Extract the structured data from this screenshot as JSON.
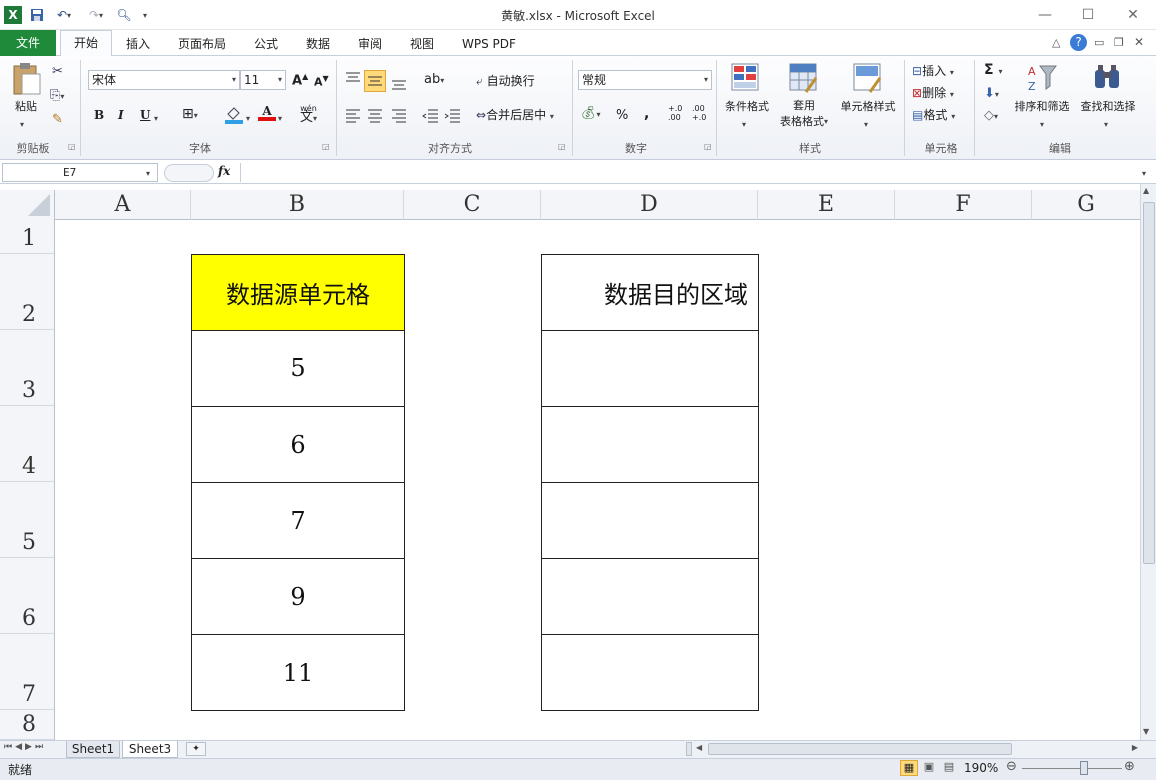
{
  "window": {
    "title": "黄敏.xlsx  -  Microsoft Excel"
  },
  "tabs": [
    "文件",
    "开始",
    "插入",
    "页面布局",
    "公式",
    "数据",
    "审阅",
    "视图",
    "WPS PDF"
  ],
  "ribbon": {
    "clipboard": {
      "paste": "粘贴",
      "label": "剪贴板"
    },
    "font": {
      "name": "宋体",
      "size": "11",
      "label": "字体",
      "bold": "B",
      "italic": "I",
      "underline": "U",
      "grow": "A",
      "shrink": "A",
      "color_a": "A",
      "wen": "wén"
    },
    "alignment": {
      "wrap": "自动换行",
      "merge": "合并后居中",
      "label": "对齐方式"
    },
    "number": {
      "format": "常规",
      "percent": "%",
      "comma": ",",
      "inc": "+.0\n.00",
      "dec": ".00\n+.0",
      "label": "数字"
    },
    "styles": {
      "cond": "条件格式",
      "table1": "套用",
      "table2": "表格格式",
      "cellstyle": "单元格样式",
      "label": "样式"
    },
    "cells": {
      "insert": "插入",
      "delete": "删除",
      "format": "格式",
      "label": "单元格"
    },
    "editing": {
      "sigma": "Σ",
      "sort": "排序和筛选",
      "find": "查找和选择",
      "label": "编辑"
    }
  },
  "formula": {
    "namebox": "E7",
    "fx": "fx",
    "value": ""
  },
  "columns": [
    "A",
    "B",
    "C",
    "D",
    "E",
    "F",
    "G"
  ],
  "rows": [
    "1",
    "2",
    "3",
    "4",
    "5",
    "6",
    "7",
    "8"
  ],
  "cells": {
    "B2": "数据源单元格",
    "B3": "5",
    "B4": "6",
    "B5": "7",
    "B6": "9",
    "B7": "11",
    "D2": "数据目的区域",
    "D3": "",
    "D4": "",
    "D5": "",
    "D6": "",
    "D7": ""
  },
  "sheets": [
    "Sheet1",
    "Sheet3"
  ],
  "status": {
    "ready": "就绪",
    "zoom": "190%"
  },
  "colors": {
    "highlight": "#ffff00",
    "file_tab": "#1f8a3a"
  }
}
